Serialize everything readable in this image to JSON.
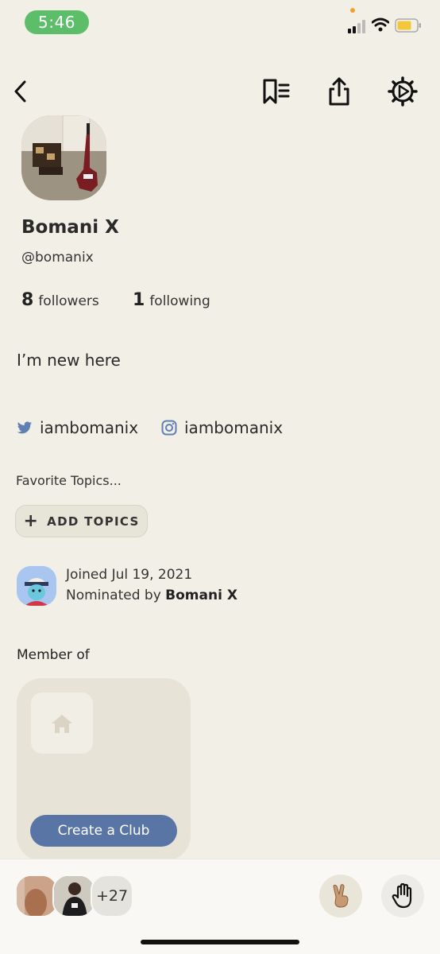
{
  "status_bar": {
    "time": "5:46",
    "time_pill_color": "#5dbe6a",
    "icons": [
      "signal-icon",
      "wifi-icon",
      "battery-icon"
    ]
  },
  "nav": {
    "icons": [
      "back-icon",
      "bookmark-list-icon",
      "share-icon",
      "settings-gear-icon"
    ]
  },
  "profile": {
    "name": "Bomani X",
    "handle": "@bomanix",
    "followers_count": "8",
    "followers_label": "followers",
    "following_count": "1",
    "following_label": "following",
    "bio": "I’m new here",
    "twitter": "iambomanix",
    "instagram": "iambomanix"
  },
  "topics": {
    "title": "Favorite Topics...",
    "add_button_label": "ADD TOPICS"
  },
  "joined": {
    "joined_text": "Joined Jul 19, 2021",
    "nominated_prefix": "Nominated by",
    "nominated_by": "Bomani X"
  },
  "clubs": {
    "title": "Member of",
    "create_label": "Create a Club",
    "accent": "#5875a6"
  },
  "bottom_bar": {
    "more_count": "+27",
    "raise_hand_icon": "raise-hand-icon",
    "peace_icon": "peace-hand-icon"
  }
}
